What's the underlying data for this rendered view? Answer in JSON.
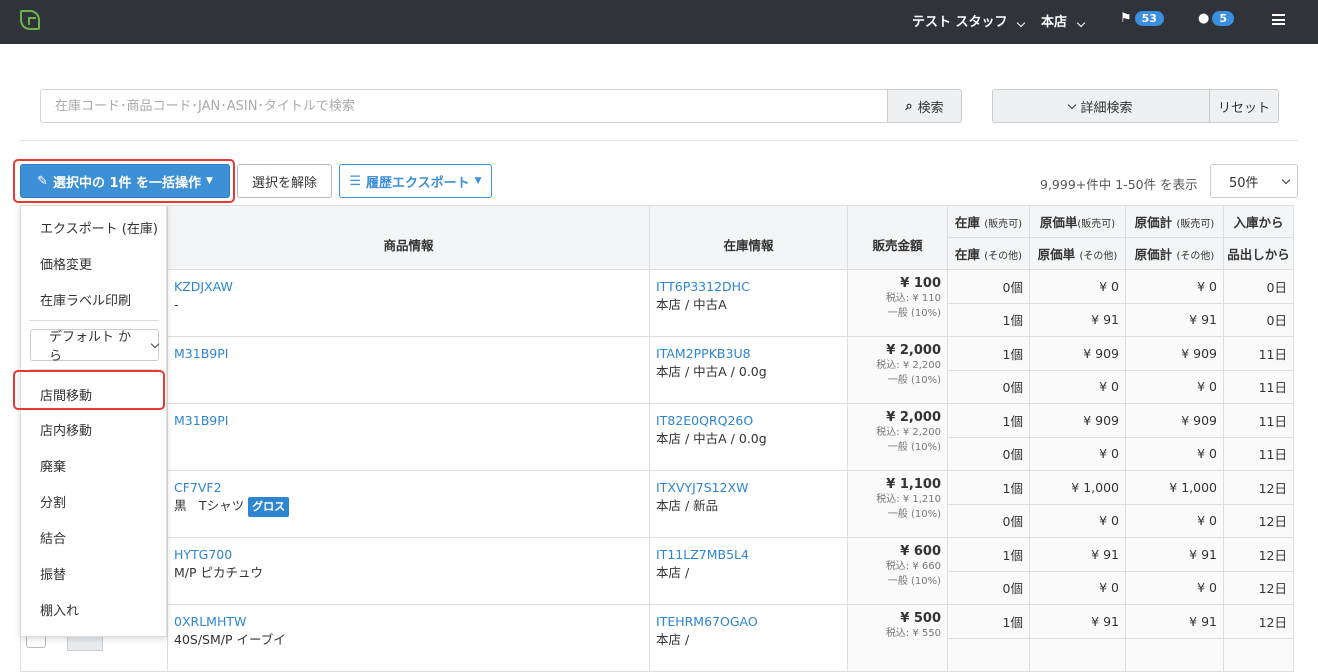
{
  "nav": {
    "user": "テスト スタッフ",
    "store": "本店",
    "flag_count": "53",
    "msg_count": "5"
  },
  "search": {
    "placeholder": "在庫コード･商品コード･JAN･ASIN･タイトルで検索",
    "button": "検索",
    "advanced": "詳細検索",
    "reset": "リセット"
  },
  "actions": {
    "bulk": "選択中の 1件 を一括操作",
    "deselect": "選択を解除",
    "export": "履歴エクスポート"
  },
  "pagination": {
    "info": "9,999+件中 1-50件 を表示",
    "per_page": "50件"
  },
  "headers": {
    "product": "商品情報",
    "stock_info": "在庫情報",
    "price": "販売金額",
    "stock": "在庫",
    "cost": "原価単",
    "cost_total": "原価計",
    "arrival": "入庫から",
    "sellable": "(販売可)",
    "other": "(その他)",
    "stock_other": "在庫",
    "cost_other": "原価単",
    "cost_total_other": "原価計",
    "shipout": "品出しから"
  },
  "dropdown": {
    "items_top": [
      "エクスポート (在庫)",
      "価格変更",
      "在庫ラベル印刷"
    ],
    "select": "デフォルト から",
    "items_bottom": [
      "店間移動",
      "店内移動",
      "廃棄",
      "分割",
      "結合",
      "振替",
      "棚入れ"
    ]
  },
  "rows": [
    {
      "code": "KZDJXAW",
      "name": "-",
      "stock_code": "ITT6P3312DHC",
      "stock_detail": "本店 / 中古A",
      "price": "¥ 100",
      "tax": "税込: ¥ 110",
      "tier": "一般 (10%)",
      "a": [
        "0個",
        "¥ 0",
        "¥ 0",
        "0日"
      ],
      "b": [
        "1個",
        "¥ 91",
        "¥ 91",
        "0日"
      ]
    },
    {
      "code": "M31B9PI",
      "name": "",
      "stock_code": "ITAM2PPKB3U8",
      "stock_detail": "本店 / 中古A / 0.0g",
      "price": "¥ 2,000",
      "tax": "税込: ¥ 2,200",
      "tier": "一般 (10%)",
      "a": [
        "1個",
        "¥ 909",
        "¥ 909",
        "11日"
      ],
      "b": [
        "0個",
        "¥ 0",
        "¥ 0",
        "11日"
      ]
    },
    {
      "code": "M31B9PI",
      "name": "",
      "stock_code": "IT82E0QRQ26O",
      "stock_detail": "本店 / 中古A / 0.0g",
      "price": "¥ 2,000",
      "tax": "税込: ¥ 2,200",
      "tier": "一般 (10%)",
      "a": [
        "1個",
        "¥ 909",
        "¥ 909",
        "11日"
      ],
      "b": [
        "0個",
        "¥ 0",
        "¥ 0",
        "11日"
      ]
    },
    {
      "code": "CF7VF2",
      "name": "黒　Tシャツ",
      "tag": "グロス",
      "stock_code": "ITXVYJ7S12XW",
      "stock_detail": "本店 / 新品",
      "price": "¥ 1,100",
      "tax": "税込: ¥ 1,210",
      "tier": "一般 (10%)",
      "a": [
        "1個",
        "¥ 1,000",
        "¥ 1,000",
        "12日"
      ],
      "b": [
        "0個",
        "¥ 0",
        "¥ 0",
        "12日"
      ]
    },
    {
      "code": "HYTG700",
      "name": "M/P ピカチュウ",
      "stock_code": "IT11LZ7MB5L4",
      "stock_detail": "本店 /",
      "price": "¥ 600",
      "tax": "税込: ¥ 660",
      "tier": "一般 (10%)",
      "a": [
        "1個",
        "¥ 91",
        "¥ 91",
        "12日"
      ],
      "b": [
        "0個",
        "¥ 0",
        "¥ 0",
        "12日"
      ]
    },
    {
      "code": "0XRLMHTW",
      "name": "40S/SM/P イーブイ",
      "stock_code": "ITEHRM67OGAO",
      "stock_detail": "本店 /",
      "price": "¥ 500",
      "tax": "税込: ¥ 550",
      "tier": "",
      "a": [
        "1個",
        "¥ 91",
        "¥ 91",
        "12日"
      ],
      "b": [
        "",
        "",
        "",
        ""
      ]
    }
  ]
}
